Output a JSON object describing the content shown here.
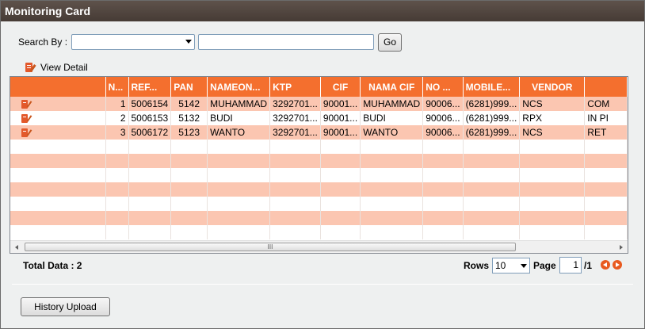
{
  "window": {
    "title": "Monitoring Card"
  },
  "search": {
    "label": "Search By :",
    "select_value": "",
    "input_value": "",
    "go_label": "Go"
  },
  "toolbar": {
    "view_detail_label": "View Detail"
  },
  "table": {
    "columns": [
      "",
      "N...",
      "REF...",
      "PAN",
      "NAMEON...",
      "KTP",
      "CIF",
      "NAMA CIF",
      "NO ...",
      "MOBILE...",
      "VENDOR",
      ""
    ],
    "rows": [
      {
        "no": "1",
        "ref": "5006154",
        "pan": "5142",
        "nameon": "MUHAMMAD",
        "ktp": "3292701...",
        "cif": "90001...",
        "nama_cif": "MUHAMMAD",
        "no_x": "90006...",
        "mobile": "(6281)999...",
        "vendor": "NCS",
        "status": "COM"
      },
      {
        "no": "2",
        "ref": "5006153",
        "pan": "5132",
        "nameon": "BUDI",
        "ktp": "3292701...",
        "cif": "90001...",
        "nama_cif": "BUDI",
        "no_x": "90006...",
        "mobile": "(6281)999...",
        "vendor": "RPX",
        "status": "IN PI"
      },
      {
        "no": "3",
        "ref": "5006172",
        "pan": "5123",
        "nameon": "WANTO",
        "ktp": "3292701...",
        "cif": "90001...",
        "nama_cif": "WANTO",
        "no_x": "90006...",
        "mobile": "(6281)999...",
        "vendor": "NCS",
        "status": "RET"
      }
    ],
    "scroll_thumb_label": "III"
  },
  "footer": {
    "total_label": "Total Data : 2",
    "rows_label": "Rows",
    "rows_value": "10",
    "page_label": "Page",
    "page_value": "1",
    "page_total": "/1"
  },
  "actions": {
    "history_upload_label": "History Upload"
  },
  "colors": {
    "header": "#f46f2e",
    "odd_row": "#fbc6b1",
    "titlebar": "#4f443e",
    "nav": "#e85a1f"
  }
}
